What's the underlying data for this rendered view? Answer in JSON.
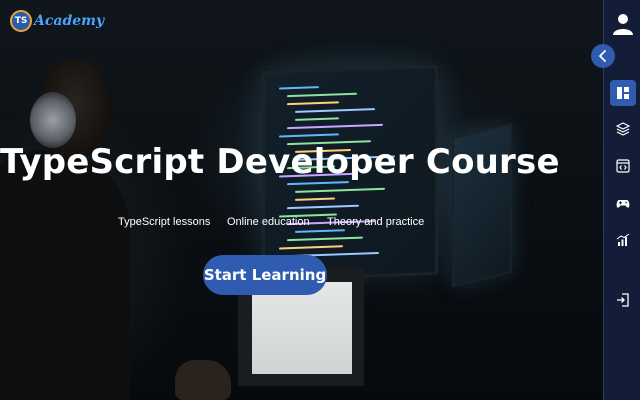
{
  "brand": {
    "logo_mark": "TS",
    "logo_text": "Academy"
  },
  "hero": {
    "title": "TypeScript Developer Course",
    "tags": [
      "TypeScript lessons",
      "Online education",
      "Theory and practice"
    ],
    "cta_label": "Start Learning"
  },
  "sidebar": {
    "items": [
      {
        "icon": "dashboard-icon",
        "active": true
      },
      {
        "icon": "layers-icon",
        "active": false
      },
      {
        "icon": "code-window-icon",
        "active": false
      },
      {
        "icon": "gamepad-icon",
        "active": false
      },
      {
        "icon": "chart-icon",
        "active": false
      },
      {
        "icon": "logout-icon",
        "active": false
      }
    ]
  },
  "colors": {
    "accent": "#2f5bb0",
    "sidebar_bg": "#141d38",
    "logo_text": "#4aa3ff",
    "logo_ring": "#e8a33a"
  }
}
